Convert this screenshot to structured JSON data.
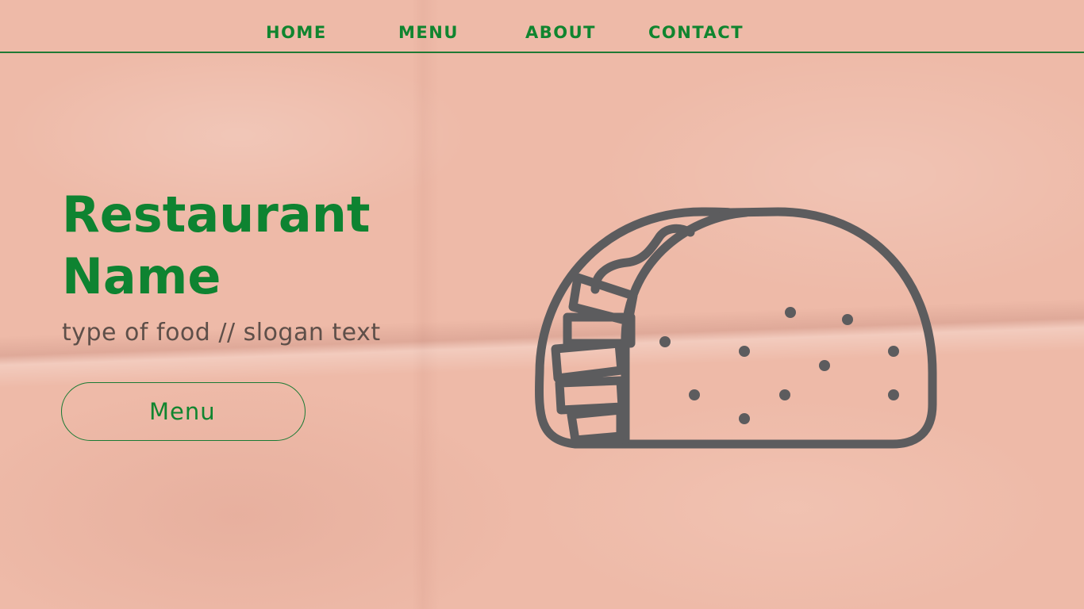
{
  "nav": {
    "items": [
      {
        "label": "HOME"
      },
      {
        "label": "MENU"
      },
      {
        "label": "ABOUT"
      },
      {
        "label": "CONTACT"
      }
    ]
  },
  "hero": {
    "title_line1": "Restaurant",
    "title_line2": "Name",
    "slogan": "type of food // slogan text",
    "button_label": "Menu"
  },
  "illustration": {
    "icon": "taco-icon",
    "stroke_color": "#5c5c5e"
  },
  "colors": {
    "background": "#eebaa8",
    "accent_green": "#10852f",
    "slogan_text": "#5e4f49"
  }
}
